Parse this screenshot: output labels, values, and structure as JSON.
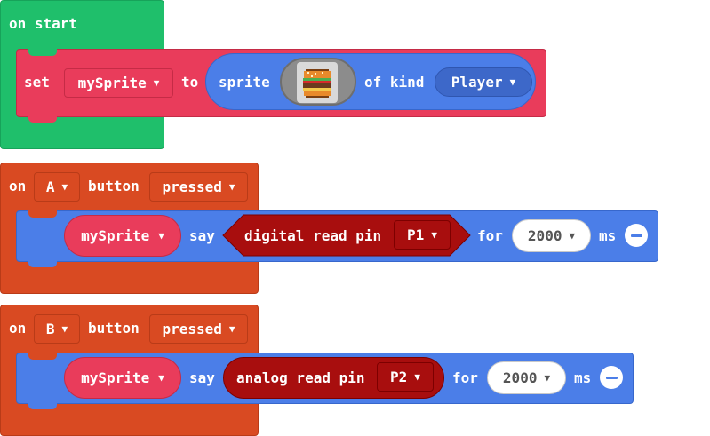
{
  "colors": {
    "events_green": "#1fbf6b",
    "controller_orange": "#d94a22",
    "sprites_red": "#e93c5b",
    "sprites_blue": "#4b7ee8",
    "pins_darkred": "#a80e0e"
  },
  "on_start": {
    "label": "on start",
    "set_block": {
      "set_label": "set",
      "variable": "mySprite",
      "to_label": "to",
      "sprite_label": "sprite",
      "image_icon": "burger-sprite-icon",
      "of_kind_label": "of kind",
      "kind": "Player"
    }
  },
  "on_button_a": {
    "on_label": "on",
    "button": "A",
    "button_label": "button",
    "event": "pressed",
    "say_block": {
      "sprite_var": "mySprite",
      "say_label": "say",
      "reader": "digital read pin",
      "pin": "P1",
      "for_label": "for",
      "duration": "2000",
      "ms_label": "ms"
    }
  },
  "on_button_b": {
    "on_label": "on",
    "button": "B",
    "button_label": "button",
    "event": "pressed",
    "say_block": {
      "sprite_var": "mySprite",
      "say_label": "say",
      "reader": "analog read pin",
      "pin": "P2",
      "for_label": "for",
      "duration": "2000",
      "ms_label": "ms"
    }
  }
}
